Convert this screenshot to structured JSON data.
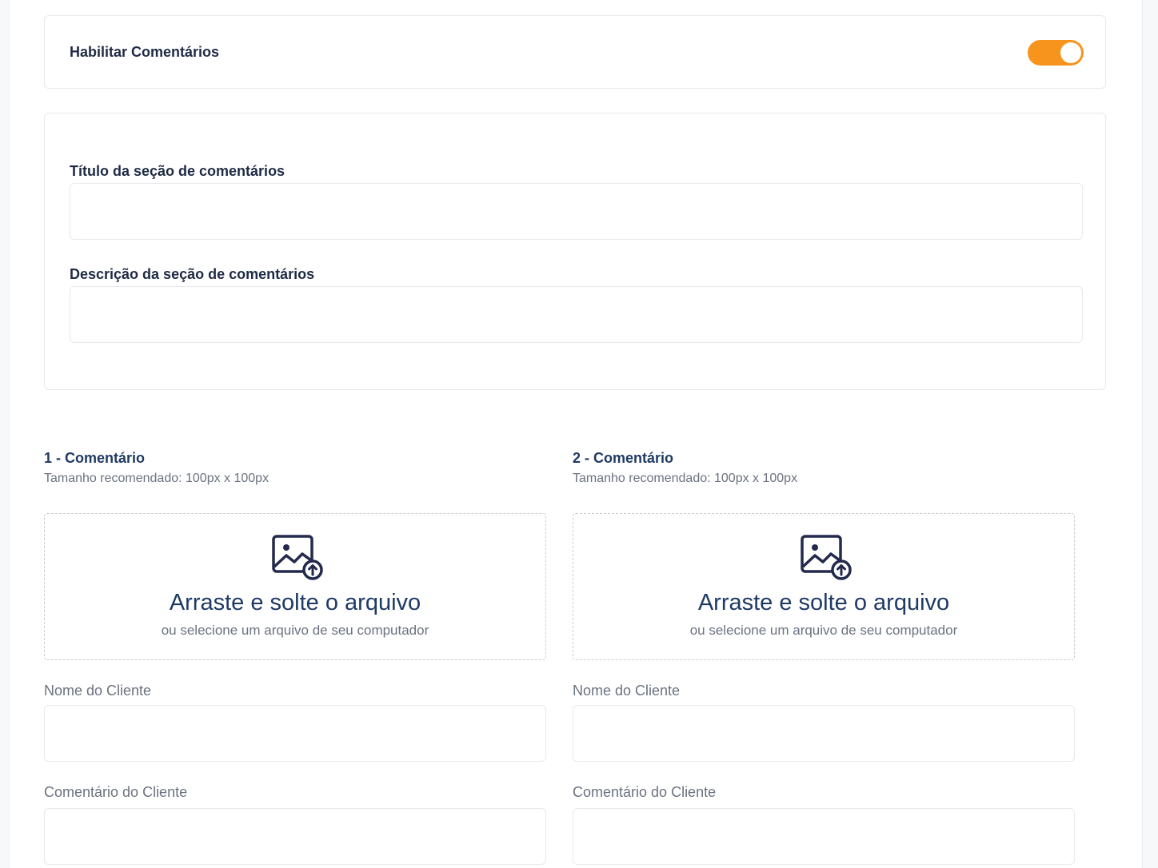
{
  "toggle_section": {
    "label": "Habilitar Comentários",
    "enabled": true,
    "accent_color": "#f7941d"
  },
  "section_fields": {
    "title_label": "Título da seção de comentários",
    "title_value": "",
    "description_label": "Descrição da seção de comentários",
    "description_value": ""
  },
  "comments": [
    {
      "heading": "1 - Comentário",
      "hint": "Tamanho recomendado: 100px x 100px",
      "dropzone_title": "Arraste e solte o arquivo",
      "dropzone_subtitle": "ou selecione um arquivo de seu computador",
      "dropzone_icon": "image-upload-icon",
      "name_label": "Nome do Cliente",
      "name_value": "",
      "comment_label": "Comentário do Cliente",
      "comment_value": ""
    },
    {
      "heading": "2 - Comentário",
      "hint": "Tamanho recomendado: 100px x 100px",
      "dropzone_title": "Arraste e solte o arquivo",
      "dropzone_subtitle": "ou selecione um arquivo de seu computador",
      "dropzone_icon": "image-upload-icon",
      "name_label": "Nome do Cliente",
      "name_value": "",
      "comment_label": "Comentário do Cliente",
      "comment_value": ""
    }
  ]
}
